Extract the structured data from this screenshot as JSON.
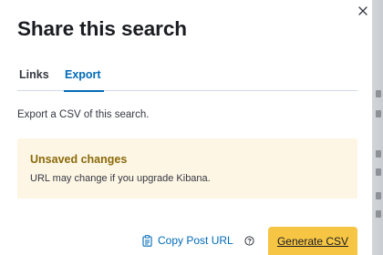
{
  "modal": {
    "title": "Share this search",
    "tabs": [
      {
        "label": "Links",
        "selected": false
      },
      {
        "label": "Export",
        "selected": true
      }
    ],
    "description": "Export a CSV of this search.",
    "callout": {
      "title": "Unsaved changes",
      "body": "URL may change if you upgrade Kibana."
    },
    "footer": {
      "copy_label": "Copy Post URL",
      "primary_label": "Generate CSV"
    }
  },
  "colors": {
    "accent": "#006bb8",
    "warning_bg": "#fef6e5",
    "warning_title": "#8a6a0a",
    "primary_button": "#f6c544"
  },
  "icons": {
    "close": "close-icon",
    "copy": "clipboard-icon",
    "help": "question-circle-icon"
  }
}
